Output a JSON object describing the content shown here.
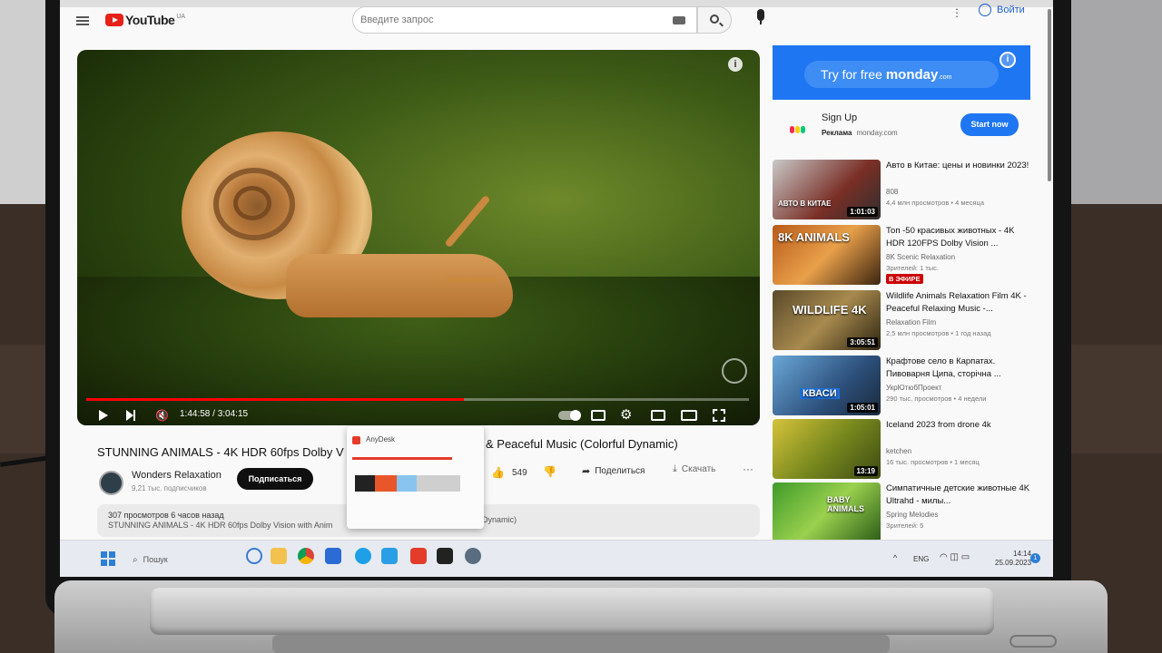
{
  "header": {
    "logo_text": "YouTube",
    "region": "UA",
    "search_placeholder": "Введите запрос",
    "login_label": "Войти"
  },
  "video": {
    "current_time": "1:44:58",
    "total_time": "3:04:15",
    "time_display": "1:44:58 / 3:04:15",
    "progress": 0.57,
    "title": "STUNNING ANIMALS - 4K HDR 60fps Dolby V",
    "title_tail": "& Peaceful Music (Colorful Dynamic)",
    "channel": "Wonders Relaxation",
    "subscribers": "9,21 тыс. подписчиков",
    "subscribe_label": "Подписаться",
    "likes": "549",
    "share_label": "Поделиться",
    "download_label": "Скачать",
    "views_line": "307 просмотров  6 часов назад",
    "desc_line": "STUNNING ANIMALS - 4K HDR 60fps Dolby Vision with Anim",
    "desc_tail": "ful Dynamic)"
  },
  "anydesk": {
    "label": "AnyDesk"
  },
  "ad": {
    "banner_text": "Try for free",
    "banner_brand": "monday",
    "banner_brand_suffix": ".com",
    "title": "Sign Up",
    "sponsor_label": "Реклама",
    "domain": "monday.com",
    "cta": "Start now"
  },
  "recommendations": [
    {
      "title": "Авто в Китае: цены и новинки 2023!",
      "channel": "808",
      "meta": "4,4 млн просмотров  • 4 месяца",
      "duration": "1:01:03",
      "thumb_label": "АВТО В КИТАЕ"
    },
    {
      "title": "Топ -50 красивых животных - 4K HDR 120FPS Dolby Vision ...",
      "channel": "8K Scenic Relaxation",
      "meta": "Зрителей: 1 тыс.",
      "badge": "В ЭФИРЕ",
      "thumb_label": "8K ANIMALS"
    },
    {
      "title": "Wildlife Animals Relaxation Film 4K - Peaceful Relaxing Music -...",
      "channel": "Relaxation Film",
      "meta": "2,5 млн просмотров  • 1 год назад",
      "duration": "3:05:51",
      "thumb_label": "WILDLIFE 4K"
    },
    {
      "title": "Крафтове село в Карпатах. Пивоварня Ципа, сторічна ...",
      "channel": "УкрЮтюбПроект",
      "meta": "290 тыс. просмотров  • 4 недели",
      "duration": "1:05:01",
      "thumb_label": "КВАСИ"
    },
    {
      "title": "Iceland 2023 from drone 4k",
      "channel": "ketchen",
      "meta": "16 тыс. просмотров  • 1 месяц",
      "duration": "13:19",
      "thumb_label": ""
    },
    {
      "title": "Симпатичные детские животные 4K Ultrahd - милы...",
      "channel": "Spring Melodies",
      "meta": "Зрителей: 5",
      "thumb_label": "BABY ANIMALS"
    }
  ],
  "taskbar": {
    "search_label": "Пошук",
    "lang": "ENG",
    "time": "14:14",
    "date": "25.09.2023",
    "notifications": "1"
  },
  "colors": {
    "accent_red": "#ff0000",
    "monday_blue": "#1f76f2"
  }
}
